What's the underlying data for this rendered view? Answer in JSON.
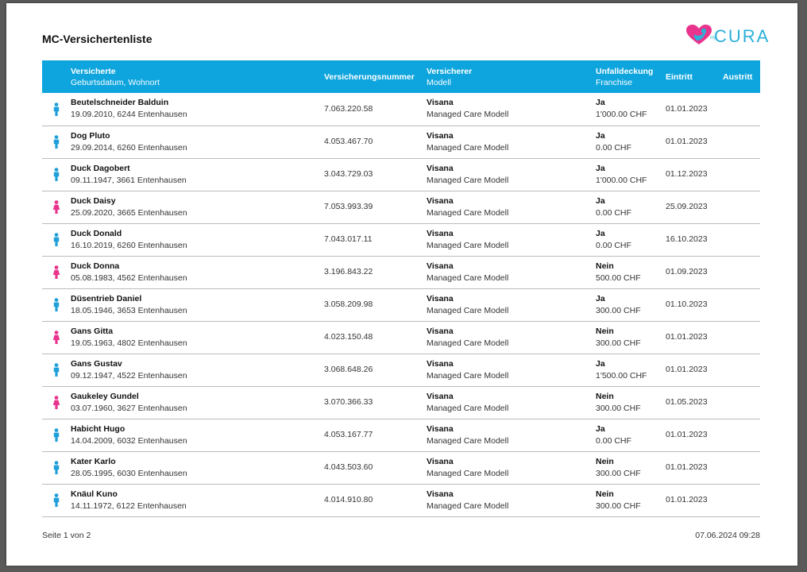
{
  "document": {
    "title": "MC-Versichertenliste",
    "logo_small": "my",
    "logo_word": "CURA",
    "footer_page": "Seite 1 von 2",
    "footer_timestamp": "07.06.2024 09:28"
  },
  "colors": {
    "header_bg": "#0ea5de",
    "male_icon": "#1e9fd9",
    "female_icon": "#e8348c"
  },
  "table": {
    "headers": {
      "insured_line1": "Versicherte",
      "insured_line2": "Geburtsdatum, Wohnort",
      "number": "Versicherungsnummer",
      "insurer_line1": "Versicherer",
      "insurer_line2": "Modell",
      "accident_line1": "Unfalldeckung",
      "accident_line2": "Franchise",
      "entry": "Eintritt",
      "exit": "Austritt"
    },
    "rows": [
      {
        "gender": "male",
        "name": "Beutelschneider Balduin",
        "details": "19.09.2010, 6244 Entenhausen",
        "number": "7.063.220.58",
        "insurer": "Visana",
        "model": "Managed Care Modell",
        "accident": "Ja",
        "franchise": "1'000.00 CHF",
        "entry": "01.01.2023",
        "exit": ""
      },
      {
        "gender": "male",
        "name": "Dog Pluto",
        "details": "29.09.2014, 6260 Entenhausen",
        "number": "4.053.467.70",
        "insurer": "Visana",
        "model": "Managed Care Modell",
        "accident": "Ja",
        "franchise": "0.00 CHF",
        "entry": "01.01.2023",
        "exit": ""
      },
      {
        "gender": "male",
        "name": "Duck Dagobert",
        "details": "09.11.1947, 3661 Entenhausen",
        "number": "3.043.729.03",
        "insurer": "Visana",
        "model": "Managed Care Modell",
        "accident": "Ja",
        "franchise": "1'000.00 CHF",
        "entry": "01.12.2023",
        "exit": ""
      },
      {
        "gender": "female",
        "name": "Duck Daisy",
        "details": "25.09.2020, 3665 Entenhausen",
        "number": "7.053.993.39",
        "insurer": "Visana",
        "model": "Managed Care Modell",
        "accident": "Ja",
        "franchise": "0.00 CHF",
        "entry": "25.09.2023",
        "exit": ""
      },
      {
        "gender": "male",
        "name": "Duck Donald",
        "details": "16.10.2019, 6260 Entenhausen",
        "number": "7.043.017.11",
        "insurer": "Visana",
        "model": "Managed Care Modell",
        "accident": "Ja",
        "franchise": "0.00 CHF",
        "entry": "16.10.2023",
        "exit": ""
      },
      {
        "gender": "female",
        "name": "Duck Donna",
        "details": "05.08.1983, 4562 Entenhausen",
        "number": "3.196.843.22",
        "insurer": "Visana",
        "model": "Managed Care Modell",
        "accident": "Nein",
        "franchise": "500.00 CHF",
        "entry": "01.09.2023",
        "exit": ""
      },
      {
        "gender": "male",
        "name": "Düsentrieb Daniel",
        "details": "18.05.1946, 3653 Entenhausen",
        "number": "3.058.209.98",
        "insurer": "Visana",
        "model": "Managed Care Modell",
        "accident": "Ja",
        "franchise": "300.00 CHF",
        "entry": "01.10.2023",
        "exit": ""
      },
      {
        "gender": "female",
        "name": "Gans Gitta",
        "details": "19.05.1963, 4802 Entenhausen",
        "number": "4.023.150.48",
        "insurer": "Visana",
        "model": "Managed Care Modell",
        "accident": "Nein",
        "franchise": "300.00 CHF",
        "entry": "01.01.2023",
        "exit": ""
      },
      {
        "gender": "male",
        "name": "Gans Gustav",
        "details": "09.12.1947, 4522 Entenhausen",
        "number": "3.068.648.26",
        "insurer": "Visana",
        "model": "Managed Care Modell",
        "accident": "Ja",
        "franchise": "1'500.00 CHF",
        "entry": "01.01.2023",
        "exit": ""
      },
      {
        "gender": "female",
        "name": "Gaukeley Gundel",
        "details": "03.07.1960, 3627 Entenhausen",
        "number": "3.070.366.33",
        "insurer": "Visana",
        "model": "Managed Care Modell",
        "accident": "Nein",
        "franchise": "300.00 CHF",
        "entry": "01.05.2023",
        "exit": ""
      },
      {
        "gender": "male",
        "name": "Habicht Hugo",
        "details": "14.04.2009, 6032 Entenhausen",
        "number": "4.053.167.77",
        "insurer": "Visana",
        "model": "Managed Care Modell",
        "accident": "Ja",
        "franchise": "0.00 CHF",
        "entry": "01.01.2023",
        "exit": ""
      },
      {
        "gender": "male",
        "name": "Kater Karlo",
        "details": "28.05.1995, 6030 Entenhausen",
        "number": "4.043.503.60",
        "insurer": "Visana",
        "model": "Managed Care Modell",
        "accident": "Nein",
        "franchise": "300.00 CHF",
        "entry": "01.01.2023",
        "exit": ""
      },
      {
        "gender": "male",
        "name": "Knäul Kuno",
        "details": "14.11.1972, 6122 Entenhausen",
        "number": "4.014.910.80",
        "insurer": "Visana",
        "model": "Managed Care Modell",
        "accident": "Nein",
        "franchise": "300.00 CHF",
        "entry": "01.01.2023",
        "exit": ""
      }
    ]
  }
}
